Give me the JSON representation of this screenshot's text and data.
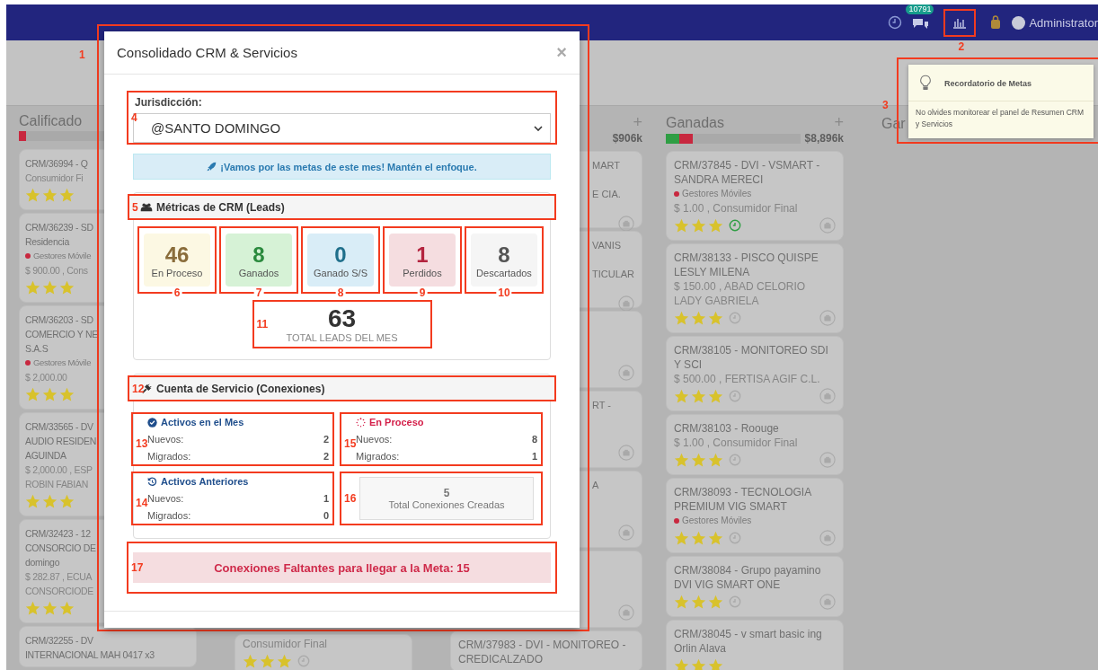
{
  "navbar": {
    "chat_badge": "10791",
    "user": "Administrator",
    "annotation": "2"
  },
  "board": {
    "columns": [
      {
        "kind": "top",
        "title": "Calificado",
        "bar": [
          {
            "color": "#c8283f",
            "level": 0.05
          }
        ],
        "cards": [
          {
            "kind": "open",
            "lines": [
              {
                "kind": "title",
                "text": "CRM/36994 - Q"
              },
              {
                "kind": "detail",
                "text": "Consumidor Fi"
              }
            ],
            "stars": 3
          },
          {
            "kind": "open",
            "lines": [
              {
                "kind": "title",
                "text": "CRM/36239 - SD"
              },
              {
                "kind": "title",
                "text": "Residencia"
              },
              {
                "kind": "tag",
                "text": "Gestores Móvile"
              },
              {
                "kind": "detail",
                "text": "$ 900.00 , Cons"
              }
            ],
            "stars": 3
          },
          {
            "kind": "open",
            "lines": [
              {
                "kind": "title",
                "text": "CRM/36203 - SD"
              },
              {
                "kind": "title",
                "text": "COMERCIO Y NE"
              },
              {
                "kind": "title",
                "text": "S.A.S"
              },
              {
                "kind": "tag",
                "text": "Gestores Móvile"
              },
              {
                "kind": "detail",
                "text": "$ 2,000.00"
              }
            ],
            "stars": 3
          },
          {
            "kind": "open",
            "lines": [
              {
                "kind": "title",
                "text": "CRM/33565 - DV"
              },
              {
                "kind": "title",
                "text": "AUDIO RESIDEN"
              },
              {
                "kind": "title",
                "text": "AGUINDA"
              },
              {
                "kind": "detail",
                "text": "$ 2,000.00 , ESP"
              },
              {
                "kind": "detail",
                "text": "ROBIN FABIAN"
              }
            ],
            "stars": 3
          },
          {
            "kind": "open",
            "lines": [
              {
                "kind": "title",
                "text": "CRM/32423 - 12"
              },
              {
                "kind": "title",
                "text": "CONSORCIO DE"
              },
              {
                "kind": "title",
                "text": "domingo"
              },
              {
                "kind": "detail",
                "text": "$ 282.87 , ECUA"
              },
              {
                "kind": "detail",
                "text": "CONSORCIODE"
              }
            ],
            "stars": 3
          },
          {
            "kind": "open",
            "lines": [
              {
                "kind": "title",
                "text": "CRM/32255 - DV"
              },
              {
                "kind": "title",
                "text": "INTERNACIONAL MAH 0417 x3"
              }
            ]
          }
        ]
      },
      {
        "kind": "bottom",
        "cards": [
          {
            "kind": "open",
            "lines": [
              {
                "kind": "detail",
                "text": "Consumidor Final"
              }
            ],
            "stars": 3,
            "clock_done": false
          }
        ]
      },
      {
        "kind": "top",
        "add": "+",
        "amount": "$906k",
        "cards": [
          {
            "kind": "covered",
            "lines": [
              {
                "kind": "title",
                "text": "MART"
              },
              {
                "kind": "title",
                "text": "E CIA."
              }
            ],
            "camera": true
          },
          {
            "kind": "covered",
            "lines": [
              {
                "kind": "title",
                "text": "VANIS"
              },
              {
                "kind": "title",
                "text": "TICULAR"
              }
            ],
            "camera": true
          },
          {
            "kind": "covered",
            "camera": true
          },
          {
            "kind": "covered",
            "lines": [
              {
                "kind": "title",
                "text": "RT -"
              }
            ],
            "camera": true
          },
          {
            "kind": "covered",
            "lines": [
              {
                "kind": "title",
                "text": "A"
              }
            ],
            "camera": true
          },
          {
            "kind": "covered",
            "camera": true
          },
          {
            "kind": "open",
            "lines": [
              {
                "kind": "title",
                "text": "CRM/37983 - DVI - MONITOREO -"
              },
              {
                "kind": "title",
                "text": "CREDICALZADO"
              }
            ]
          }
        ]
      },
      {
        "kind": "top",
        "title": "Ganadas",
        "add": "+",
        "amount": "$8,896k",
        "bar": [
          {
            "color": "#2f9e44",
            "level": 0.1
          },
          {
            "color": "#c8283f",
            "level": 0.1
          }
        ],
        "cards": [
          {
            "kind": "open",
            "lines": [
              {
                "kind": "title",
                "text": "CRM/37845 - DVI - VSMART - SANDRA MERECI"
              },
              {
                "kind": "tag",
                "text": "Gestores Móviles"
              },
              {
                "kind": "detail",
                "text": "$ 1.00 , Consumidor Final"
              }
            ],
            "stars": 3,
            "clock_done": true,
            "camera": true
          },
          {
            "kind": "open",
            "lines": [
              {
                "kind": "title",
                "text": "CRM/38133 - PISCO QUISPE LESLY MILENA"
              },
              {
                "kind": "detail",
                "text": "$ 150.00 , ABAD CELORIO LADY GABRIELA"
              }
            ],
            "stars": 3,
            "clock_done": false,
            "camera": true
          },
          {
            "kind": "open",
            "lines": [
              {
                "kind": "title",
                "text": "CRM/38105 - MONITOREO SDI Y SCI"
              },
              {
                "kind": "detail",
                "text": "$ 500.00 , FERTISA AGIF C.L."
              }
            ],
            "stars": 3,
            "clock_done": false,
            "camera": true
          },
          {
            "kind": "open",
            "lines": [
              {
                "kind": "title",
                "text": "CRM/38103 - Roouge"
              },
              {
                "kind": "detail",
                "text": "$ 1.00 , Consumidor Final"
              }
            ],
            "stars": 3,
            "clock_done": false,
            "camera": true
          },
          {
            "kind": "open",
            "lines": [
              {
                "kind": "title",
                "text": "CRM/38093 - TECNOLOGIA PREMIUM VIG SMART"
              },
              {
                "kind": "tag",
                "text": "Gestores Móviles"
              }
            ],
            "stars": 3,
            "clock_done": false,
            "camera": true
          },
          {
            "kind": "open",
            "lines": [
              {
                "kind": "title",
                "text": "CRM/38084 - Grupo payamino DVI VIG SMART ONE"
              }
            ],
            "stars": 3,
            "clock_done": false,
            "camera": true
          },
          {
            "kind": "open",
            "lines": [
              {
                "kind": "title",
                "text": "CRM/38045 - v smart basic ing Orlin Alava"
              }
            ],
            "stars": 3
          }
        ]
      },
      {
        "kind": "top",
        "title": "Gar"
      }
    ]
  },
  "reminder": {
    "annotation": "3",
    "title": "Recordatorio de Metas",
    "text": "No olvides monitorear el panel de Resumen CRM y Servicios"
  },
  "modal": {
    "annotation": "1",
    "title": "Consolidado CRM & Servicios",
    "close": "×",
    "jurisdiction": {
      "annotation": "4",
      "label": "Jurisdicción:",
      "value": "@SANTO DOMINGO"
    },
    "motivation": "¡Vamos por las metas de este mes! Mantén el enfoque.",
    "leads": {
      "annotation": "5",
      "heading": "Métricas de CRM (Leads)",
      "stats": [
        {
          "kind": "warning",
          "value": "46",
          "label": "En Proceso",
          "annotation": "6"
        },
        {
          "kind": "success",
          "value": "8",
          "label": "Ganados",
          "annotation": "7"
        },
        {
          "kind": "info",
          "value": "0",
          "label": "Ganado S/S",
          "annotation": "8"
        },
        {
          "kind": "danger",
          "value": "1",
          "label": "Perdidos",
          "annotation": "9"
        },
        {
          "kind": "default",
          "value": "8",
          "label": "Descartados",
          "annotation": "10"
        }
      ],
      "total": {
        "annotation": "11",
        "value": "63",
        "label": "TOTAL LEADS DEL MES"
      }
    },
    "services": {
      "annotation": "12",
      "heading": "Cuenta de Servicio (Conexiones)",
      "groups": [
        {
          "kind": "active",
          "title": "Activos en el Mes",
          "annotation": "13",
          "rows": [
            {
              "label": "Nuevos:",
              "value": "2"
            },
            {
              "label": "Migrados:",
              "value": "2"
            }
          ]
        },
        {
          "kind": "progress",
          "title": "En Proceso",
          "annotation": "15",
          "rows": [
            {
              "label": "Nuevos:",
              "value": "8"
            },
            {
              "label": "Migrados:",
              "value": "1"
            }
          ]
        },
        {
          "kind": "history",
          "title": "Activos Anteriores",
          "annotation": "14",
          "rows": [
            {
              "label": "Nuevos:",
              "value": "1"
            },
            {
              "label": "Migrados:",
              "value": "0"
            }
          ]
        }
      ],
      "total": {
        "annotation": "16",
        "value": "5",
        "label": "Total Conexiones Creadas"
      }
    },
    "missing": {
      "annotation": "17",
      "text": "Conexiones Faltantes para llegar a la Meta: 15"
    }
  }
}
